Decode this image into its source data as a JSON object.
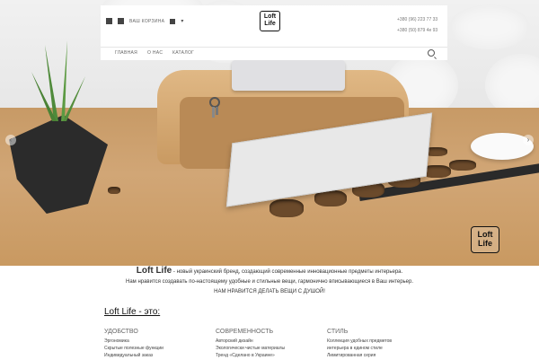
{
  "brand": {
    "name": "Loft Life",
    "logo_line1": "Loft",
    "logo_line2": "Life"
  },
  "header": {
    "cart_label": "ВАШ КОРЗИНА",
    "phones": [
      "+380 (96) 223 77 33",
      "+380 (50) 879 4e 93"
    ],
    "nav": [
      "ГЛАВНАЯ",
      "О НАС",
      "КАТАЛОГ"
    ]
  },
  "intro": {
    "line1_suffix": "- новый украинский бренд, создающий современные инновационные предметы интерьера.",
    "line2": "Нам нравится создавать по-настоящему удобные и стильные вещи, гармонично вписывающиеся в Ваш интерьер.",
    "line3": "НАМ НРАВИТСЯ ДЕЛАТЬ ВЕЩИ С ДУШОЙ!"
  },
  "features": {
    "title": "Loft Life - это:",
    "columns": [
      {
        "heading": "УДОБСТВО",
        "items": [
          "Эргономика",
          "Скрытые полезные функции",
          "Индивидуальный заказ"
        ]
      },
      {
        "heading": "СОВРЕМЕННОСТЬ",
        "items": [
          "Авторский дизайн",
          "Экологически чистые материалы",
          "Тренд «Сделано в Украине»"
        ]
      },
      {
        "heading": "СТИЛЬ",
        "items": [
          "Коллекция удобных предметов",
          "интерьера в едином стиле",
          "Лимитированная серия"
        ]
      }
    ]
  },
  "colors": {
    "accent": "#333333",
    "wood": "#c99a62"
  }
}
